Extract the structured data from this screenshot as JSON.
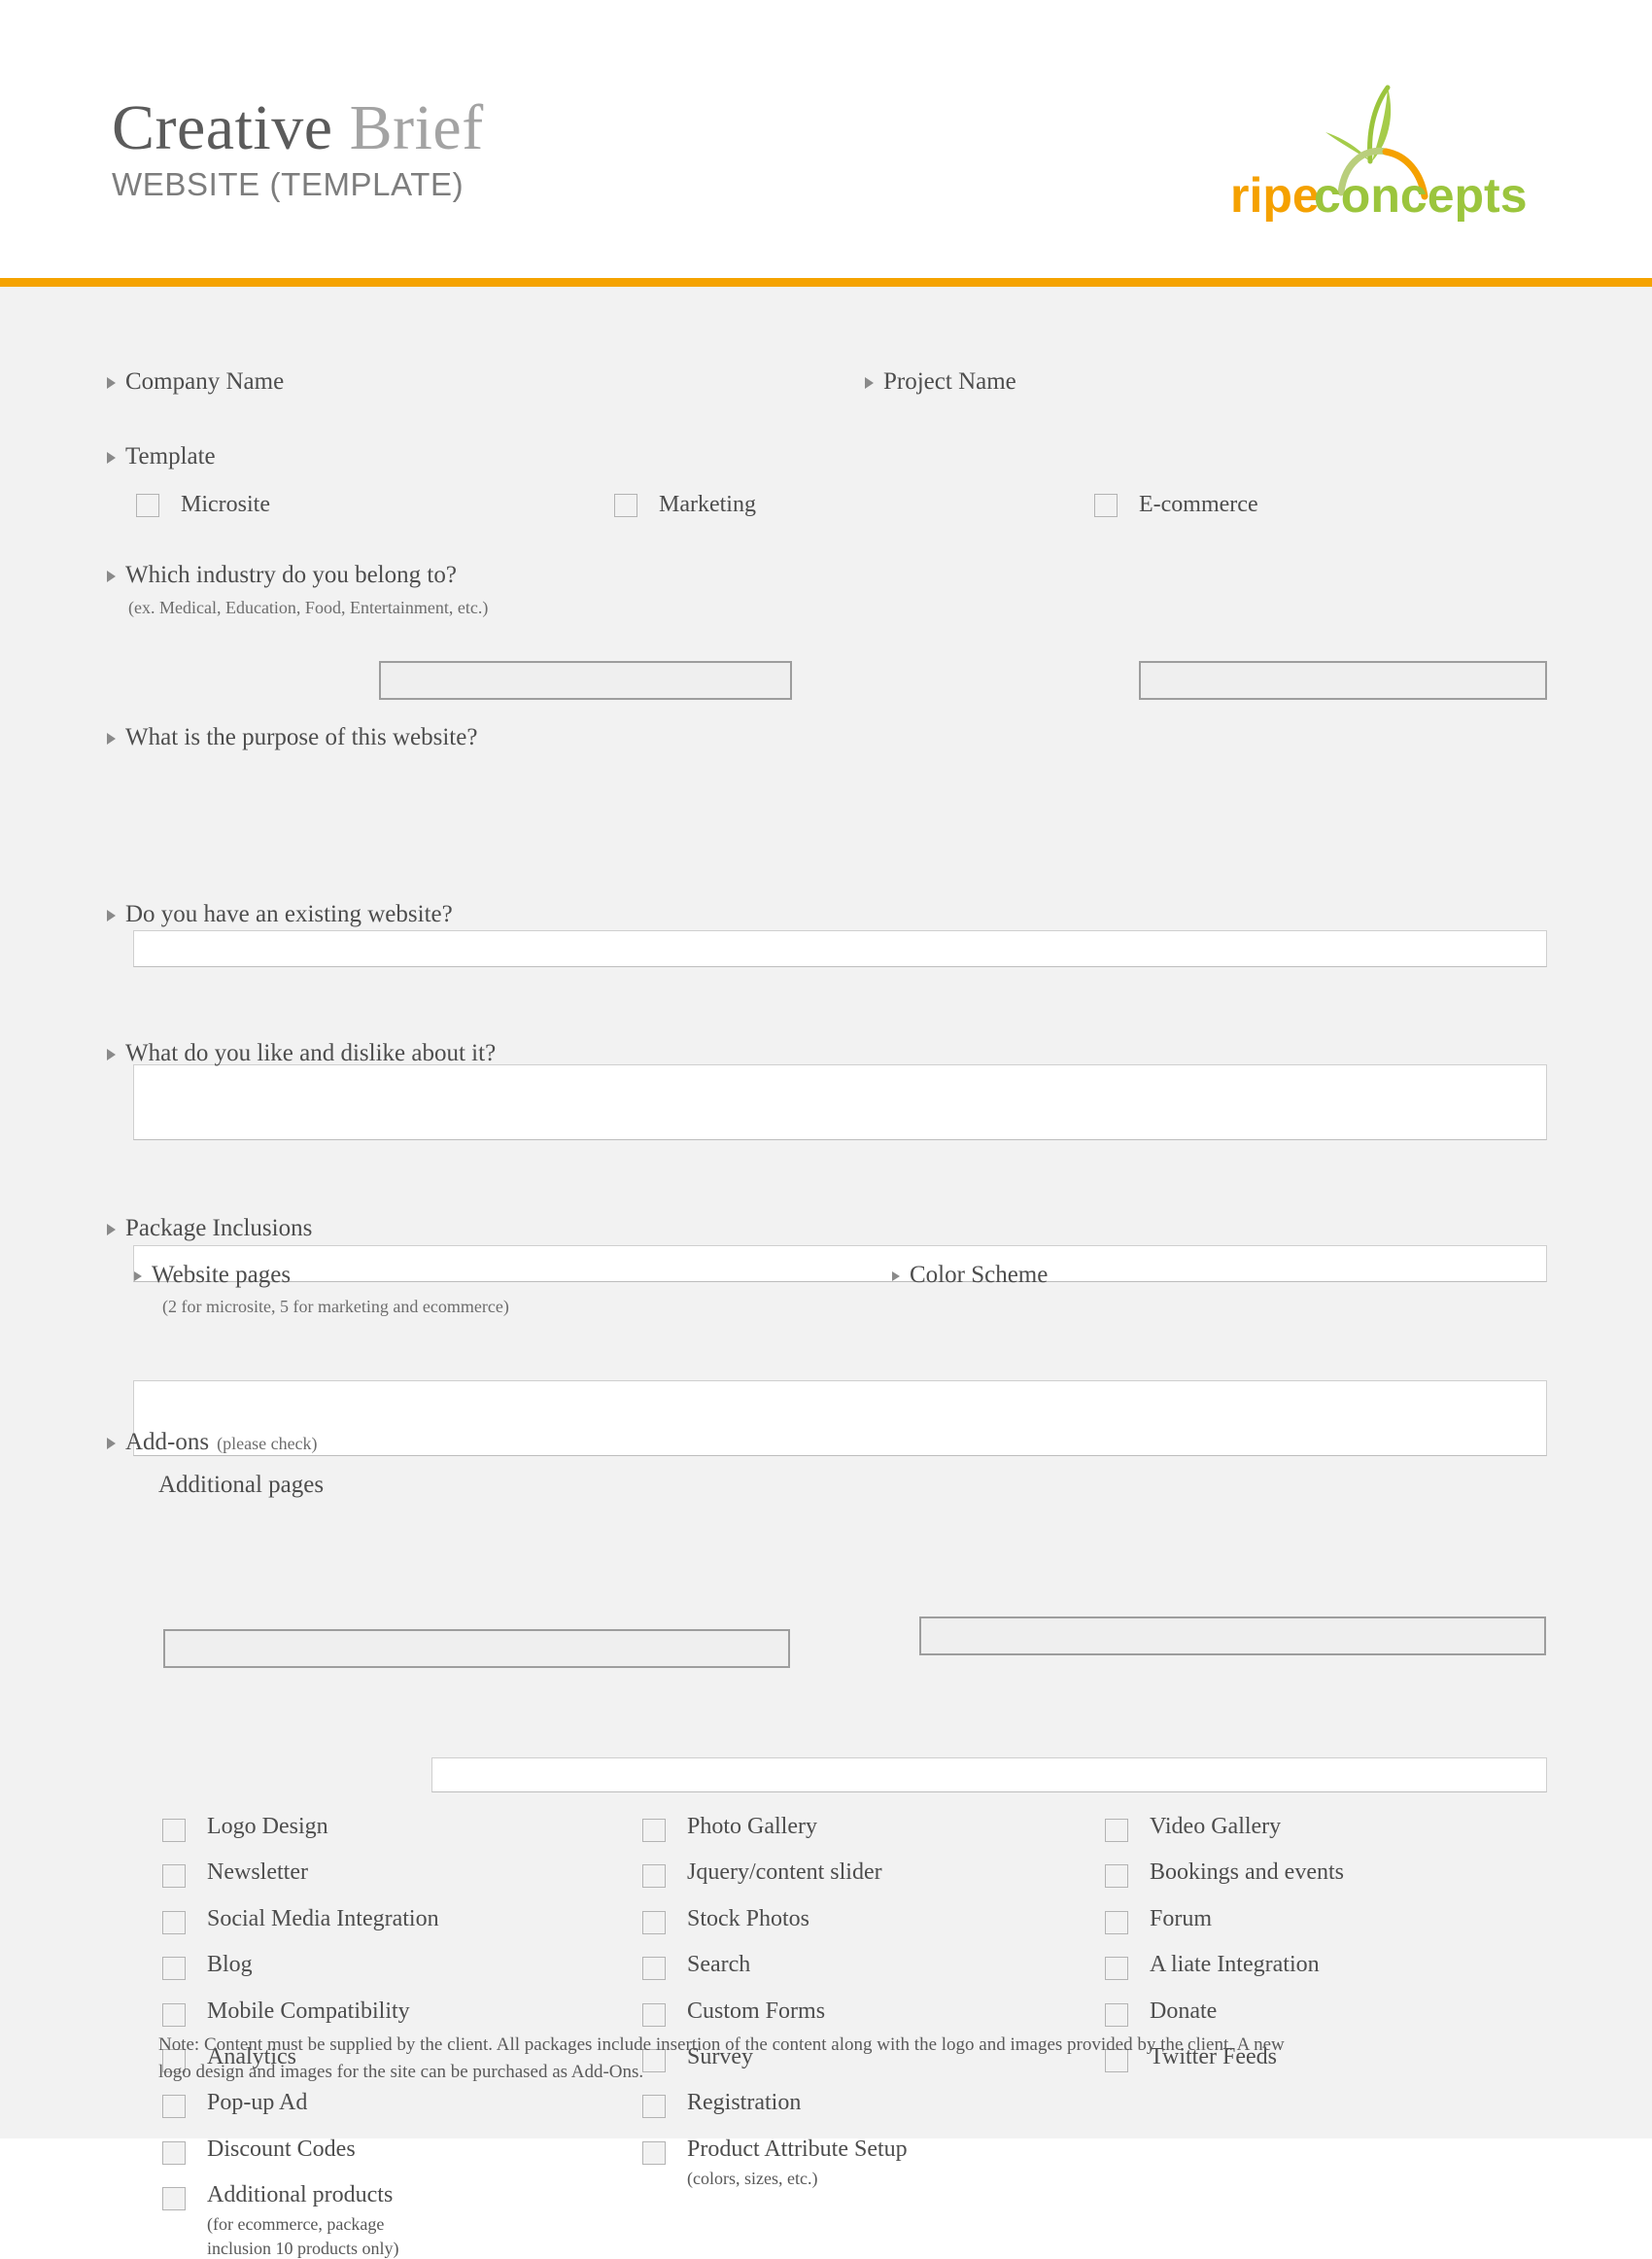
{
  "header": {
    "title_word_1": "Creative",
    "title_word_2": "Brief",
    "subtitle": "WEBSITE (TEMPLATE)",
    "logo_text_1": "ripe",
    "logo_text_2": "concepts",
    "accent_color": "#F5A300",
    "logo_orange": "#F5A100",
    "logo_green": "#9BC53D"
  },
  "form": {
    "company_name": {
      "label": "Company Name",
      "value": "",
      "placeholder": ""
    },
    "project_name": {
      "label": "Project Name",
      "value": "",
      "placeholder": ""
    },
    "template": {
      "label": "Template",
      "options": [
        {
          "label": "Microsite",
          "checked": false
        },
        {
          "label": "Marketing",
          "checked": false
        },
        {
          "label": "E-commerce",
          "checked": false
        }
      ]
    },
    "industry": {
      "label": "Which industry do you belong to?",
      "hint": "(ex. Medical, Education, Food, Entertainment, etc.)",
      "value": "",
      "placeholder": ""
    },
    "purpose": {
      "label": "What is the purpose of this website?",
      "value": "",
      "placeholder": ""
    },
    "existing_website": {
      "label": "Do you have an existing website?",
      "value": "",
      "placeholder": ""
    },
    "like_dislike": {
      "label": "What do you like and dislike about it?",
      "value": "",
      "placeholder": ""
    },
    "package_inclusions": {
      "label": "Package Inclusions",
      "website_pages": {
        "label": "Website pages",
        "hint": "(2 for microsite, 5 for marketing and ecommerce)",
        "value": "",
        "placeholder": ""
      },
      "color_scheme": {
        "label": "Color Scheme",
        "value": "",
        "placeholder": ""
      }
    },
    "addons": {
      "label": "Add-ons",
      "label_hint": "(please check)",
      "additional_pages": {
        "label": "Additional pages",
        "value": "",
        "placeholder": ""
      },
      "column_1": [
        {
          "label": "Logo Design",
          "checked": false
        },
        {
          "label": "Newsletter",
          "checked": false
        },
        {
          "label": "Social Media Integration",
          "checked": false
        },
        {
          "label": "Blog",
          "checked": false
        },
        {
          "label": "Mobile Compatibility",
          "checked": false
        },
        {
          "label": "Analytics",
          "checked": false
        },
        {
          "label": "Pop-up Ad",
          "checked": false
        },
        {
          "label": "Discount Codes",
          "checked": false
        },
        {
          "label": "Additional products",
          "sub_line_1": "(for ecommerce, package",
          "sub_line_2": "inclusion 10 products only)",
          "checked": false
        }
      ],
      "column_2": [
        {
          "label": "Photo Gallery",
          "checked": false
        },
        {
          "label": "Jquery/content slider",
          "checked": false
        },
        {
          "label": "Stock Photos",
          "checked": false
        },
        {
          "label": "Search",
          "checked": false
        },
        {
          "label": "Custom Forms",
          "checked": false
        },
        {
          "label": "Survey",
          "checked": false
        },
        {
          "label": "Registration",
          "checked": false
        },
        {
          "label": "Product Attribute Setup",
          "sub_line_1": "(colors, sizes, etc.)",
          "checked": false
        }
      ],
      "column_3": [
        {
          "label": "Video Gallery",
          "checked": false
        },
        {
          "label": "Bookings and events",
          "checked": false
        },
        {
          "label": "Forum",
          "checked": false
        },
        {
          "label": "A  liate Integration",
          "checked": false
        },
        {
          "label": "Donate",
          "checked": false
        },
        {
          "label": "Twitter Feeds",
          "checked": false
        }
      ]
    }
  },
  "footer": {
    "note_line_1": "Note: Content must be supplied by the client. All packages include insertion of the content along with the logo and images provided by the client. A new",
    "note_line_2": "logo design and images for the site can be purchased as Add-Ons."
  }
}
